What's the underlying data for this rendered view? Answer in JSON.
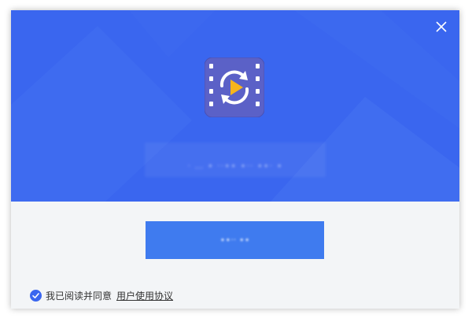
{
  "colors": {
    "hero_bg": "#3a66ef",
    "accent": "#3f7bef",
    "footer_bg": "#f3f5f7",
    "text": "#333333"
  },
  "header": {
    "close_icon": "close-icon",
    "app_icon": "video-converter-icon",
    "app_name": "· … ∙ ··∙∙ ∙·· ∙∙· ∙"
  },
  "main": {
    "install_label": "∙∙·· ∙∙"
  },
  "footer": {
    "agree_checked": true,
    "agree_text": "我已阅读并同意",
    "agreement_link": "用户使用协议"
  }
}
